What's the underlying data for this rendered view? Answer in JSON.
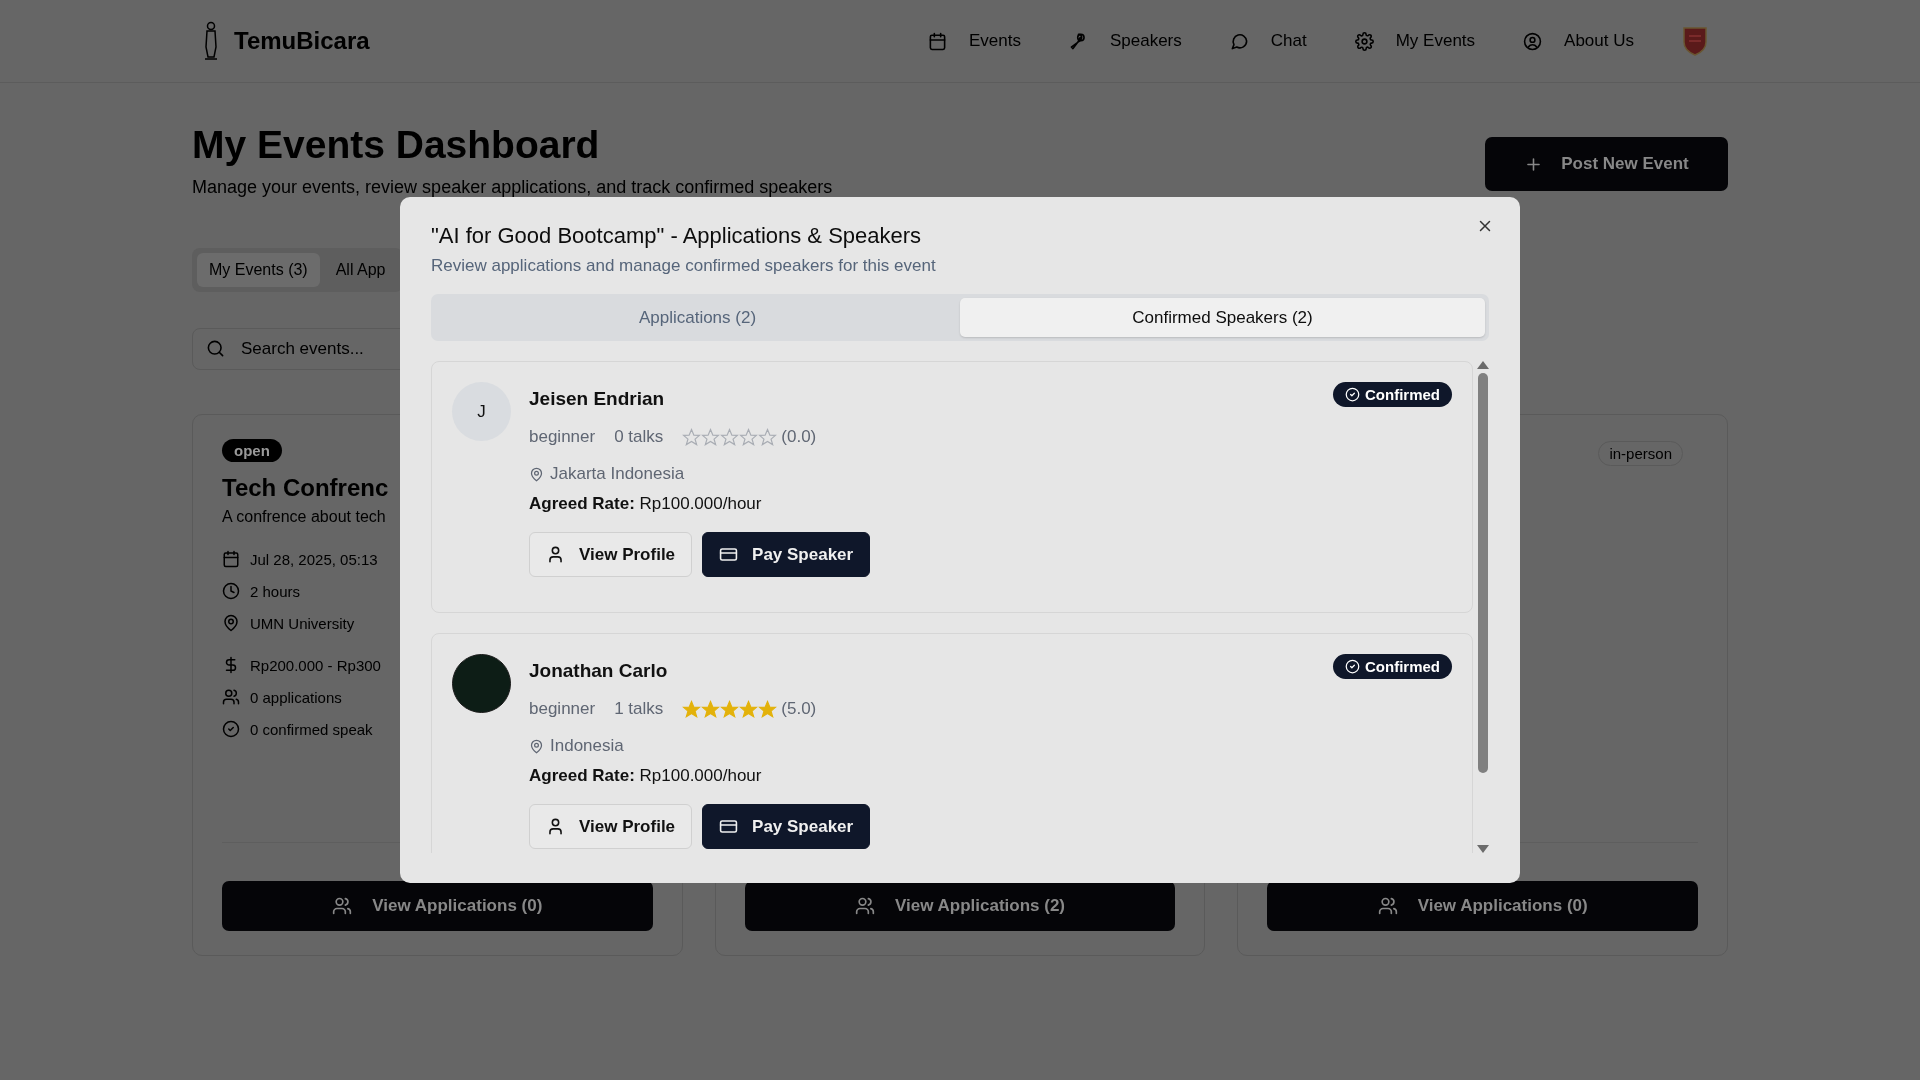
{
  "header": {
    "brand": "TemuBicara",
    "nav": [
      {
        "label": "Events"
      },
      {
        "label": "Speakers"
      },
      {
        "label": "Chat"
      },
      {
        "label": "My Events"
      },
      {
        "label": "About Us"
      }
    ]
  },
  "page": {
    "title": "My Events Dashboard",
    "subtitle": "Manage your events, review speaker applications, and track confirmed speakers",
    "post_button": "Post New Event",
    "tabs": [
      {
        "label": "My Events (3)",
        "selected": true
      },
      {
        "label": "All App",
        "selected": false
      }
    ],
    "search": {
      "placeholder": "Search events..."
    },
    "event_cards": [
      {
        "status": "open",
        "title": "Tech Confrenc",
        "description": "A confrence about tech",
        "details": [
          {
            "kind": "date",
            "text": "Jul 28, 2025, 05:13"
          },
          {
            "kind": "duration",
            "text": "2 hours"
          },
          {
            "kind": "location",
            "text": "UMN University"
          },
          {
            "kind": "price",
            "text": "Rp200.000 - Rp300"
          },
          {
            "kind": "applications",
            "text": "0 applications"
          },
          {
            "kind": "confirmed",
            "text": "0 confirmed speak"
          }
        ],
        "button": "View Applications (0)"
      },
      {
        "button": "View Applications (2)"
      },
      {
        "format": "in-person",
        "button": "View Applications (0)"
      }
    ]
  },
  "modal": {
    "title": "\"AI for Good Bootcamp\" - Applications & Speakers",
    "subtitle": "Review applications and manage confirmed speakers for this event",
    "tabs": [
      {
        "label": "Applications (2)",
        "selected": false
      },
      {
        "label": "Confirmed Speakers (2)",
        "selected": true
      }
    ],
    "speakers": [
      {
        "avatar": {
          "kind": "initial",
          "text": "J"
        },
        "name": "Jeisen Endrian",
        "status": "Confirmed",
        "experience": "beginner",
        "talks": "0 talks",
        "stars": 0,
        "rating": "(0.0)",
        "location": "Jakarta Indonesia",
        "rate_label": "Agreed Rate:",
        "rate": "Rp100.000/hour",
        "buttons": [
          {
            "kind": "outline",
            "label": "View Profile"
          },
          {
            "kind": "solid",
            "label": "Pay Speaker"
          }
        ]
      },
      {
        "avatar": {
          "kind": "image"
        },
        "name": "Jonathan Carlo",
        "status": "Confirmed",
        "experience": "beginner",
        "talks": "1 talks",
        "stars": 5,
        "rating": "(5.0)",
        "location": "Indonesia",
        "rate_label": "Agreed Rate:",
        "rate": "Rp100.000/hour",
        "buttons": [
          {
            "kind": "outline",
            "label": "View Profile"
          },
          {
            "kind": "solid",
            "label": "Pay Speaker"
          }
        ]
      }
    ]
  }
}
